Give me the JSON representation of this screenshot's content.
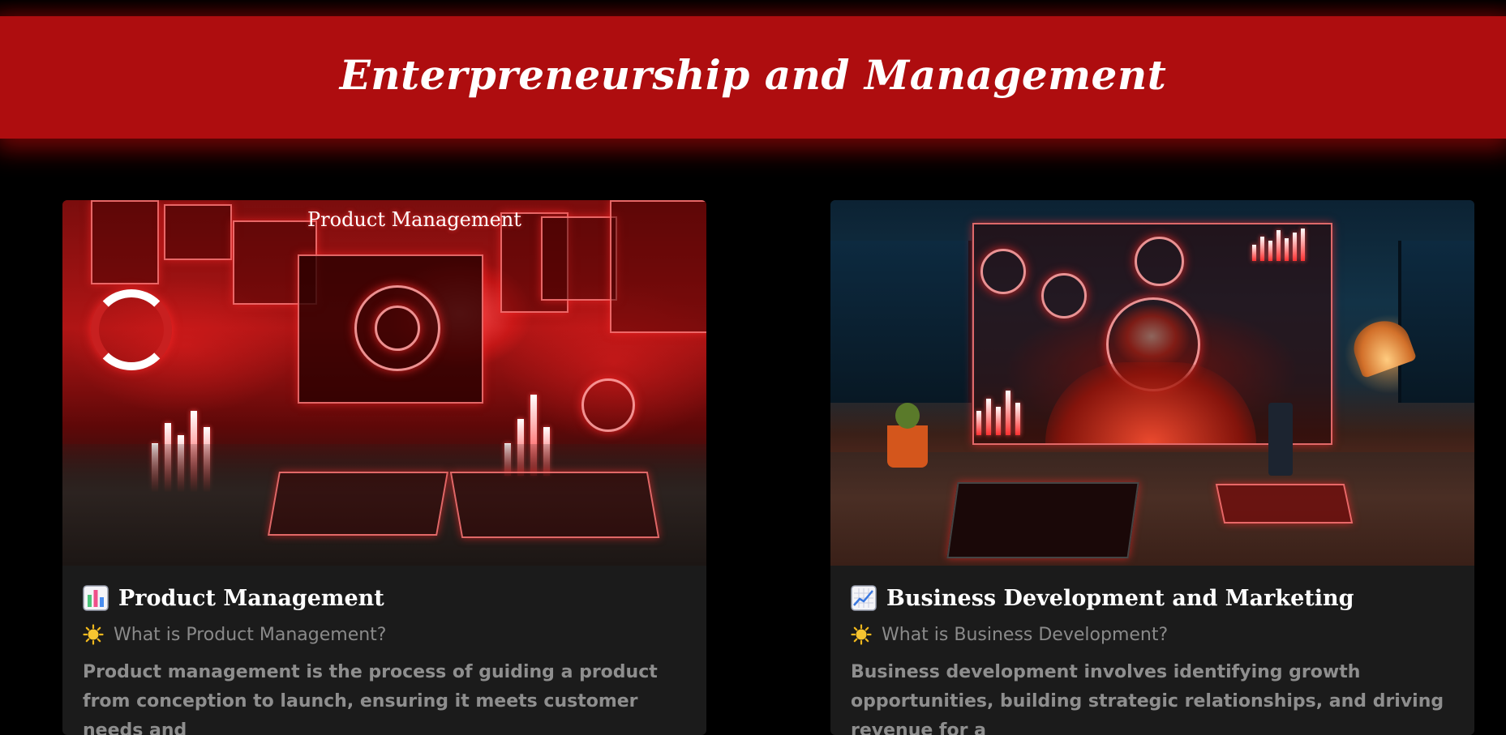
{
  "header": {
    "title": "Enterpreneurship and Management"
  },
  "cards": [
    {
      "image_text": "Product Management",
      "image_alt": "Product Management",
      "icon": "bar-chart-icon",
      "title": "Product Management",
      "subtitle_icon": "sun-icon",
      "subtitle": "What is Product Management?",
      "description": "Product management is the process of guiding a product from conception to launch, ensuring it meets customer needs and"
    },
    {
      "image_alt": "Business Development and Marketing",
      "icon": "chart-increasing-icon",
      "title": "Business Development and Marketing",
      "subtitle_icon": "sun-icon",
      "subtitle": "What is Business Development?",
      "description": "Business development involves identifying growth opportunities, building strategic relationships, and driving revenue for a"
    }
  ],
  "colors": {
    "background": "#000000",
    "banner": "#ae0d0f",
    "card": "#1b1b1b",
    "title_text": "#ffffff",
    "muted_text": "#8e8e8e"
  }
}
